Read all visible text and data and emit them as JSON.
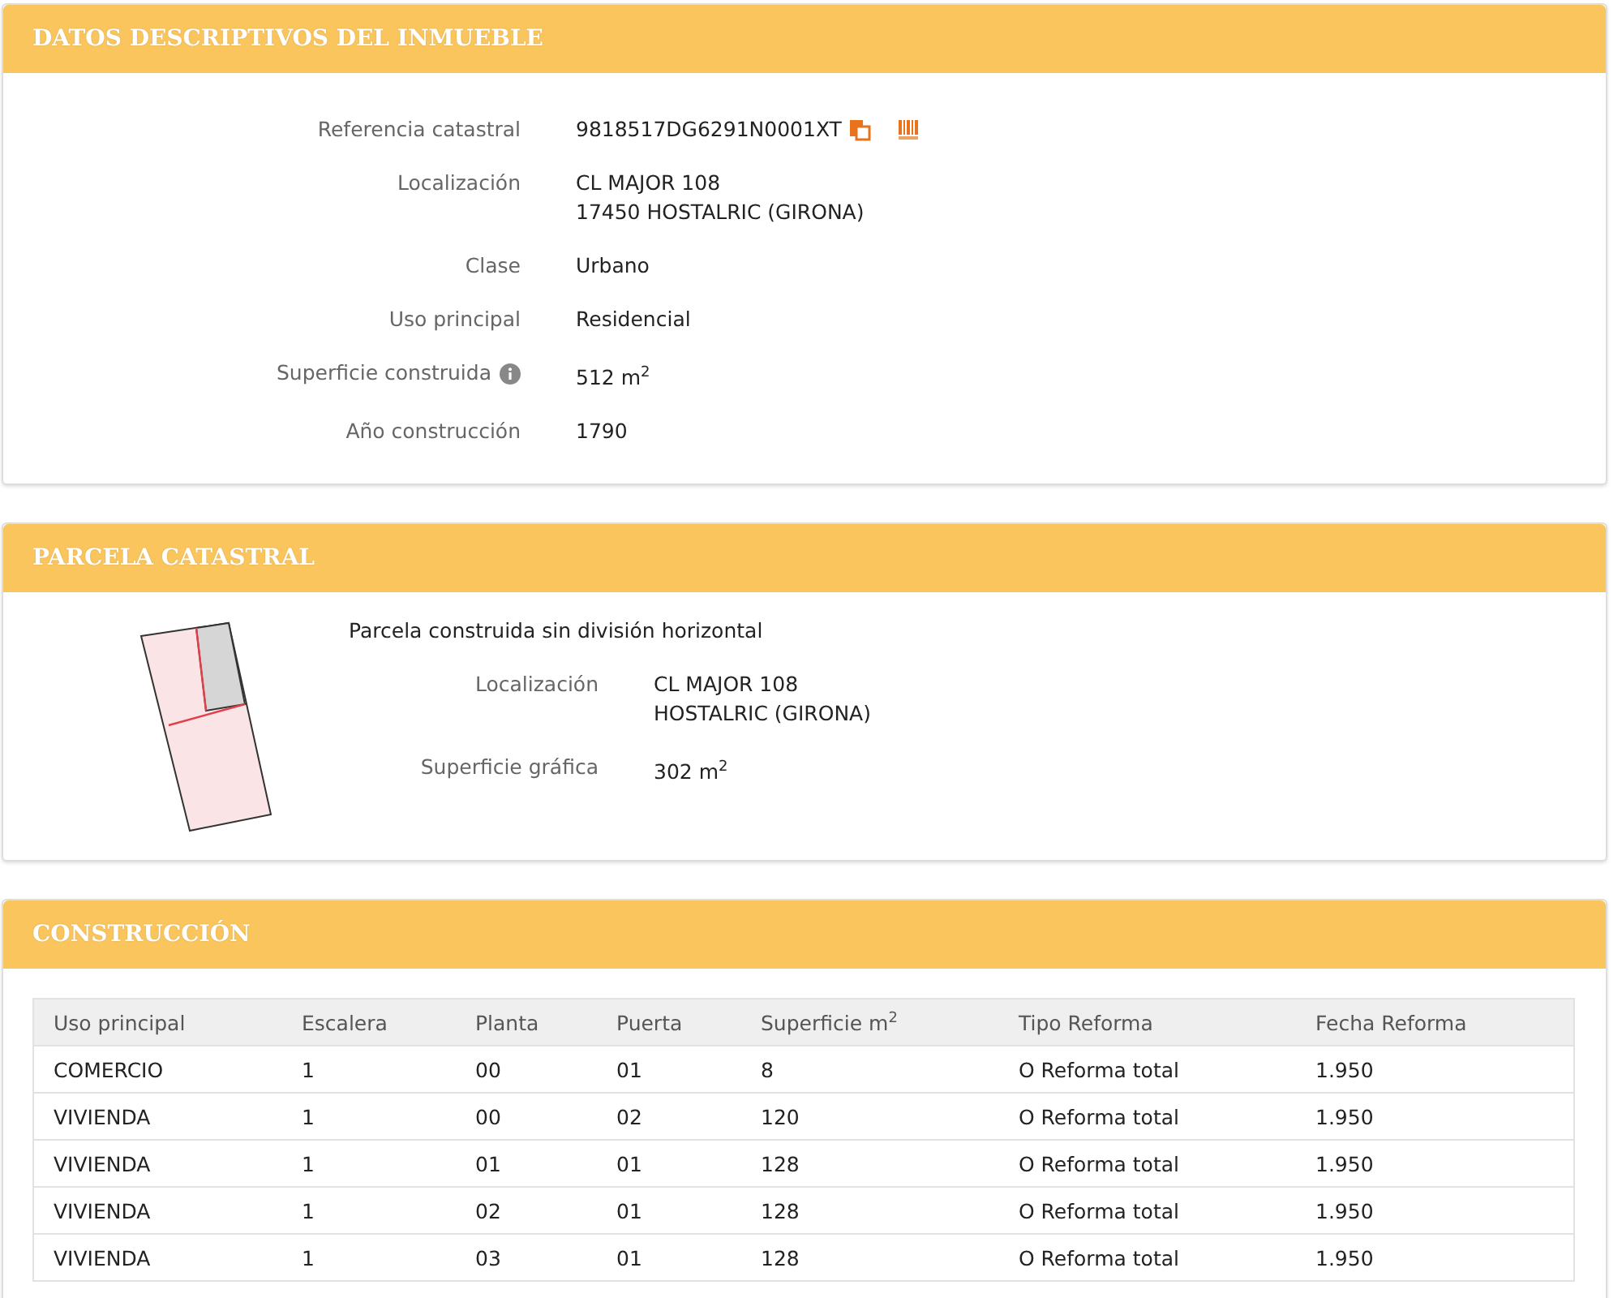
{
  "sections": [
    {
      "kind": "fields",
      "title": "DATOS DESCRIPTIVOS DEL INMUEBLE",
      "fields": [
        {
          "kind": "reference",
          "label": "Referencia catastral",
          "lines": [
            "9818517DG6291N0001XT"
          ]
        },
        {
          "kind": "plain",
          "label": "Localización",
          "lines": [
            "CL MAJOR 108",
            "17450 HOSTALRIC (GIRONA)"
          ]
        },
        {
          "kind": "plain",
          "label": "Clase",
          "lines": [
            "Urbano"
          ]
        },
        {
          "kind": "plain",
          "label": "Uso principal",
          "lines": [
            "Residencial"
          ]
        },
        {
          "kind": "info",
          "label": "Superficie construida",
          "lines": [
            "512 m$^{2}$"
          ]
        },
        {
          "kind": "plain",
          "label": "Año construcción",
          "lines": [
            "1790"
          ]
        }
      ]
    },
    {
      "kind": "parcel",
      "title": "PARCELA CATASTRAL",
      "description": "Parcela construida sin división horizontal",
      "fields": [
        {
          "kind": "plain",
          "label": "Localización",
          "lines": [
            "CL MAJOR 108",
            "HOSTALRIC (GIRONA)"
          ]
        },
        {
          "kind": "plain",
          "label": "Superficie gráfica",
          "lines": [
            "302 m$^{2}$"
          ]
        }
      ]
    },
    {
      "kind": "table",
      "title": "CONSTRUCCIÓN",
      "columns": [
        "Uso principal",
        "Escalera",
        "Planta",
        "Puerta",
        "Superficie m$^{2}$",
        "Tipo Reforma",
        "Fecha Reforma"
      ],
      "rows": [
        [
          "COMERCIO",
          "1",
          "00",
          "01",
          "8",
          "O Reforma total",
          "1.950"
        ],
        [
          "VIVIENDA",
          "1",
          "00",
          "02",
          "120",
          "O Reforma total",
          "1.950"
        ],
        [
          "VIVIENDA",
          "1",
          "01",
          "01",
          "128",
          "O Reforma total",
          "1.950"
        ],
        [
          "VIVIENDA",
          "1",
          "02",
          "01",
          "128",
          "O Reforma total",
          "1.950"
        ],
        [
          "VIVIENDA",
          "1",
          "03",
          "01",
          "128",
          "O Reforma total",
          "1.950"
        ]
      ]
    }
  ]
}
